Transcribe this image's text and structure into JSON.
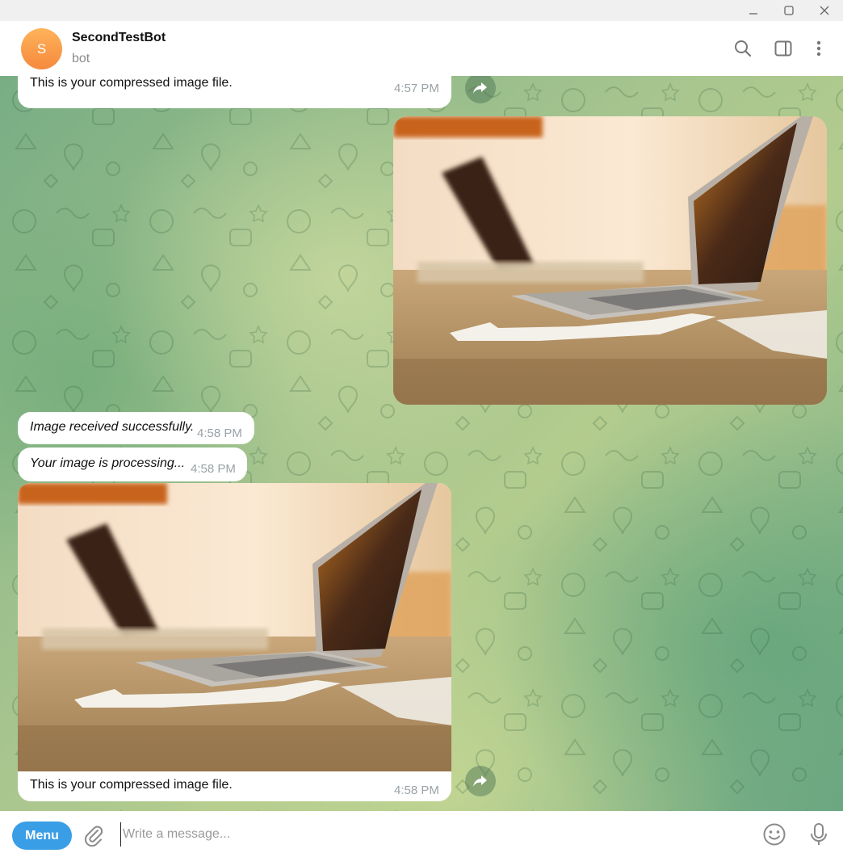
{
  "window": {
    "minimize_label": "—",
    "maximize_label": "☐",
    "close_label": "✕"
  },
  "header": {
    "avatar_letter": "S",
    "title": "SecondTestBot",
    "subtitle": "bot",
    "icons": [
      "search-icon",
      "side-panel-icon",
      "more-vertical-icon"
    ]
  },
  "messages": [
    {
      "kind": "text",
      "side": "left",
      "text": "This is your compressed image file.",
      "time": "4:57 PM"
    },
    {
      "kind": "photo",
      "side": "right",
      "description_icon": "laptop-photo"
    },
    {
      "kind": "text",
      "side": "left",
      "italic": true,
      "text": "Image received successfully.",
      "time": "4:58 PM"
    },
    {
      "kind": "text",
      "side": "left",
      "italic": true,
      "text": "Your image is processing...",
      "time": "4:58 PM"
    },
    {
      "kind": "photo-caption",
      "side": "left",
      "text": "This is your compressed image file.",
      "time": "4:58 PM"
    }
  ],
  "composer": {
    "placeholder": "Write a message...",
    "value": ""
  },
  "bottom": {
    "menu_label": "Menu",
    "icons": [
      "attach-icon",
      "emoji-icon",
      "microphone-icon"
    ]
  },
  "colors": {
    "accent": "#3a9ee6",
    "avatar": "#f5893d",
    "bubble": "#ffffff",
    "time": "#9aa3a8"
  }
}
